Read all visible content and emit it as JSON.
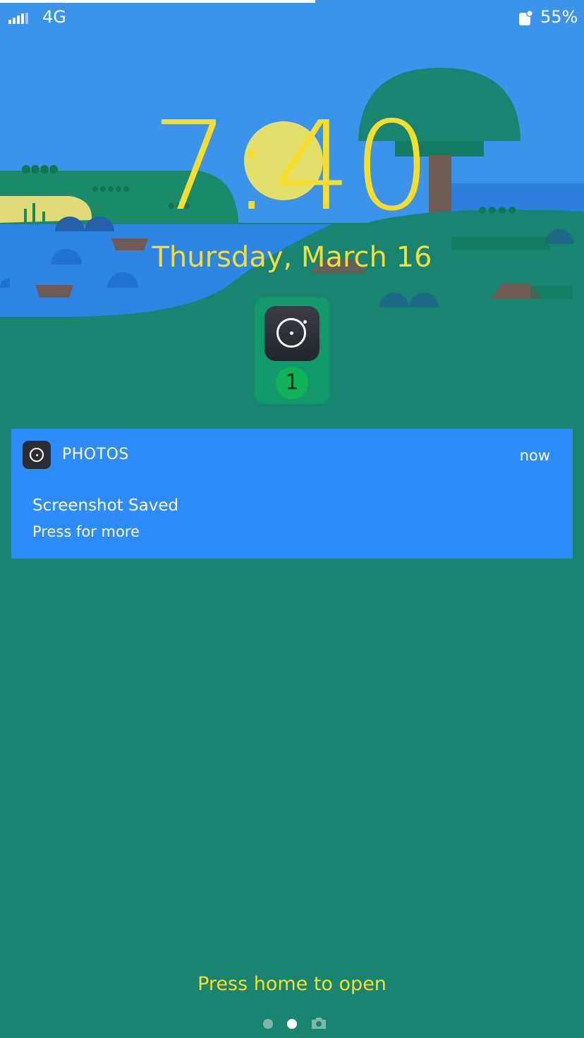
{
  "status_bar": {
    "network": "4G",
    "battery_percent": "55%",
    "progress_fraction": 0.54
  },
  "lockscreen": {
    "time": "7:40",
    "date": "Thursday, March 16",
    "app_badge_count": "1",
    "hint": "Press home to open",
    "page_dots": [
      "page-1",
      "page-2-active",
      "camera"
    ]
  },
  "notification": {
    "app_name": "PHOTOS",
    "time": "now",
    "title": "Screenshot Saved",
    "body": "Press for more"
  },
  "colors": {
    "sky": "#3b94ea",
    "ground": "#198470",
    "accent_text": "#f7de2d",
    "notification_bg": "#2d8bfc",
    "badge_bg": "#11996b"
  }
}
